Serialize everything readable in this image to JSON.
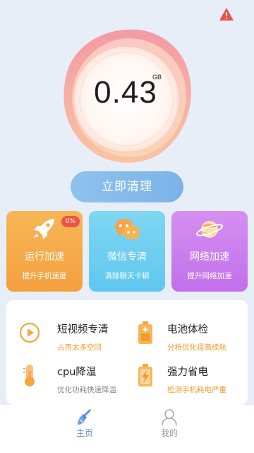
{
  "header": {
    "alert_icon": "warning-icon",
    "alert_color": "#e9534a"
  },
  "storage": {
    "value": "0.43",
    "unit": "GB"
  },
  "clean_button": {
    "label": "立即清理"
  },
  "cards": [
    {
      "title": "运行加速",
      "subtitle": "提升手机速度",
      "badge": "0%",
      "icon": "rocket-icon",
      "color": "#f4a640"
    },
    {
      "title": "微信专清",
      "subtitle": "清除聊天卡顿",
      "icon": "wechat-icon",
      "color": "#66cbef"
    },
    {
      "title": "网络加速",
      "subtitle": "提升网络加速",
      "icon": "planet-icon",
      "color": "#c97aee"
    }
  ],
  "features": [
    {
      "title": "短视频专清",
      "subtitle": "占用太多空间",
      "icon": "play-icon"
    },
    {
      "title": "电池体检",
      "subtitle": "分析优化提高续航",
      "icon": "battery-icon"
    },
    {
      "title": "cpu降温",
      "subtitle": "优化功耗快速降温",
      "icon": "thermometer-icon"
    },
    {
      "title": "强力省电",
      "subtitle": "检测手机耗电严重",
      "icon": "battery-charge-icon"
    }
  ],
  "nav": [
    {
      "label": "主页",
      "icon": "broom-icon",
      "active": true
    },
    {
      "label": "我的",
      "icon": "user-icon",
      "active": false
    }
  ]
}
